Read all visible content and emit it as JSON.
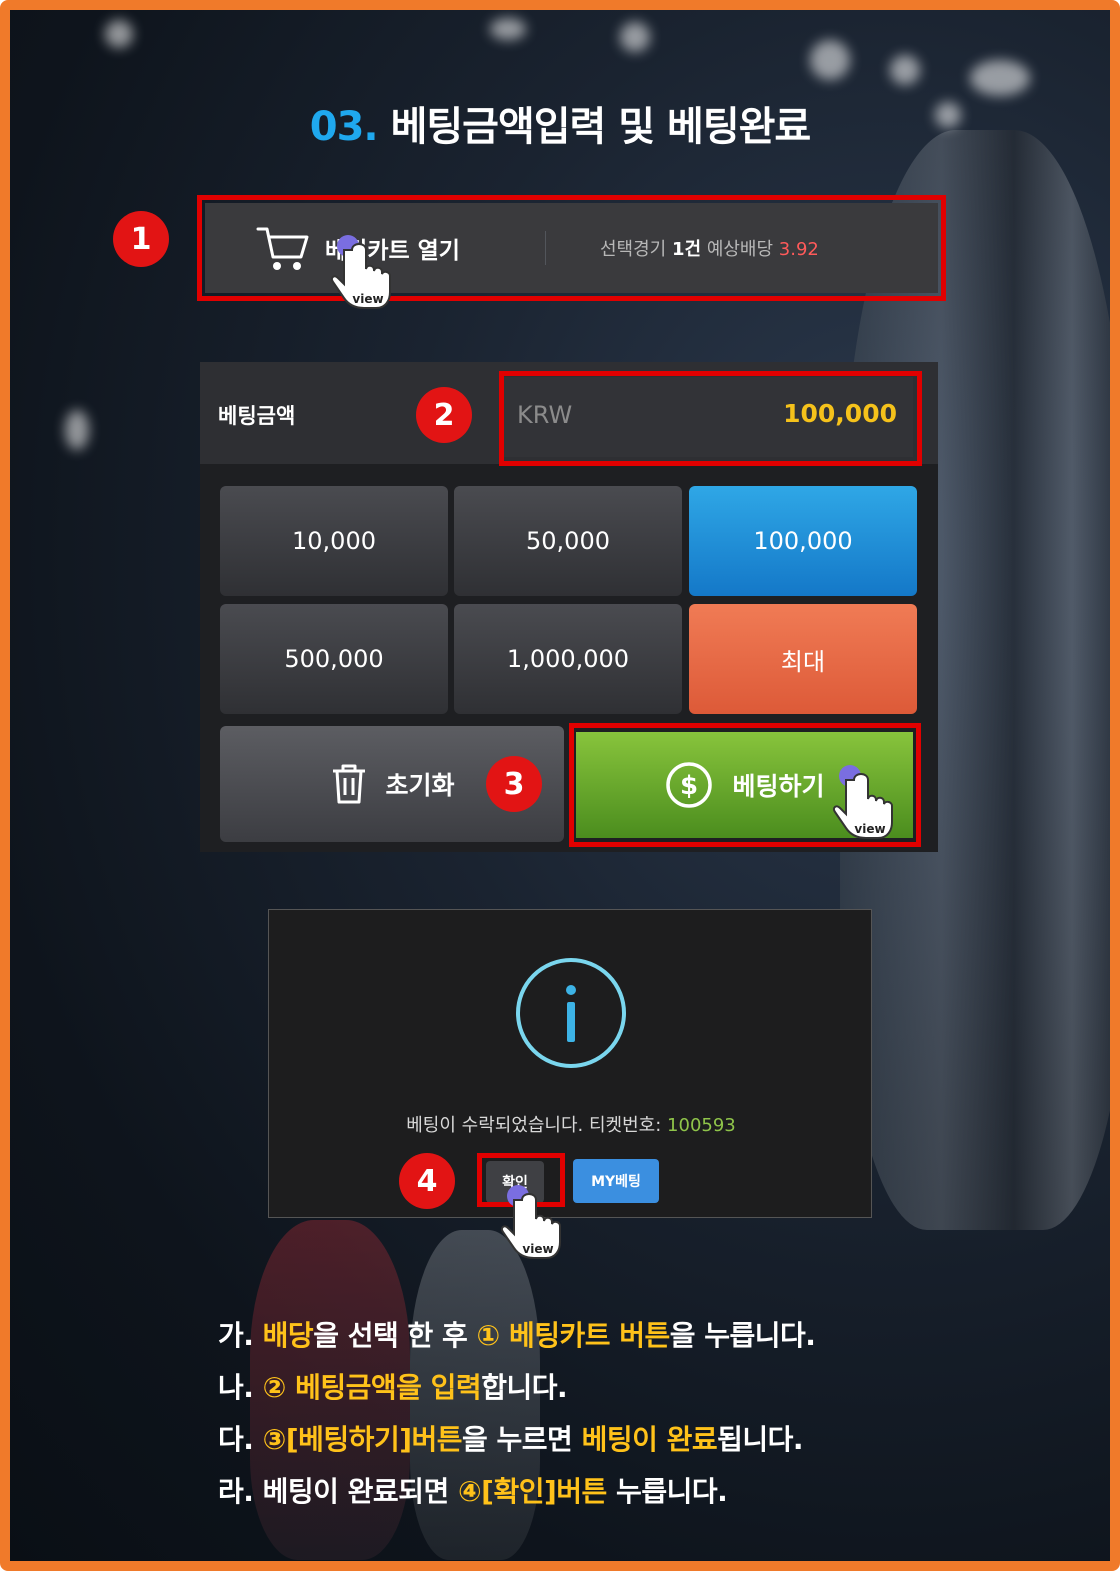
{
  "title": {
    "number": "03.",
    "text": "베팅금액입력 및 베팅완료"
  },
  "colors": {
    "accent_blue": "#1fa8ee",
    "highlight_red": "#e10000",
    "amount_yellow": "#f5c21b",
    "odds_red": "#ff5a5a",
    "bet_green": "#6aae2c",
    "chip_blue": "#1f8fd8",
    "chip_orange": "#e86a44",
    "step_yellow": "#ffc21a"
  },
  "badges": [
    "1",
    "2",
    "3",
    "4"
  ],
  "cart_bar": {
    "icon": "cart-icon",
    "label": "베팅카트 열기",
    "selected_label": "선택경기",
    "selected_count": "1건",
    "odds_label": "예상배당",
    "odds_value": "3.92",
    "cursor_text": "view"
  },
  "amount": {
    "label": "베팅금액",
    "currency": "KRW",
    "value": "100,000"
  },
  "chips": [
    {
      "label": "10,000",
      "selected": false
    },
    {
      "label": "50,000",
      "selected": false
    },
    {
      "label": "100,000",
      "selected": true
    },
    {
      "label": "500,000",
      "selected": false
    },
    {
      "label": "1,000,000",
      "selected": false
    },
    {
      "label": "최대",
      "selected": false
    }
  ],
  "reset_button": {
    "icon": "trash-icon",
    "label": "초기화"
  },
  "bet_button": {
    "icon": "dollar-icon",
    "label": "베팅하기",
    "cursor_text": "view"
  },
  "dialog": {
    "icon": "info-icon",
    "message": "베팅이 수락되었습니다. 티켓번호:",
    "ticket_number": "100593",
    "ok_label": "확인",
    "my_bets_label": "MY베팅",
    "cursor_text": "view"
  },
  "steps": [
    {
      "prefix": "가. ",
      "a": "배당",
      "b": "을 선택 한 후 ",
      "c": "① 베팅카트 버튼",
      "d": "을 누릅니다."
    },
    {
      "prefix": "나. ",
      "a": "② 베팅금액을 입력",
      "b": "합니다.",
      "c": "",
      "d": ""
    },
    {
      "prefix": "다. ",
      "a": "③[베팅하기]버튼",
      "b": "을  누르면 ",
      "c": "베팅이 완료",
      "d": "됩니다."
    },
    {
      "prefix": "라. 베팅이 완료되면 ",
      "a": "④[확인]버튼",
      "b": " 누릅니다.",
      "c": "",
      "d": ""
    }
  ]
}
